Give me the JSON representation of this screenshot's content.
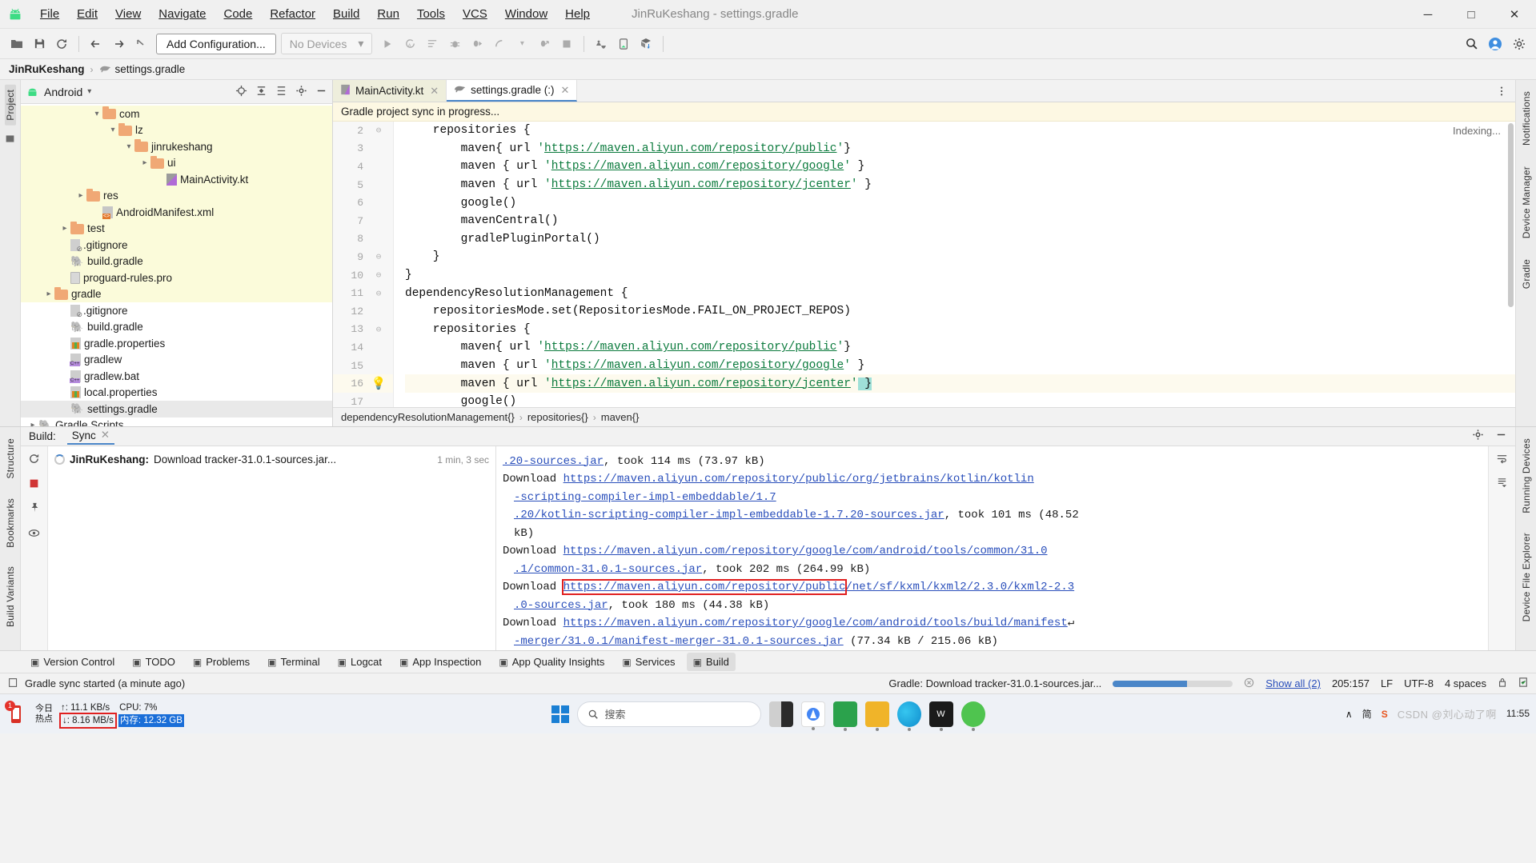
{
  "titlebar": {
    "logo_icon": "android-logo-icon",
    "menus": [
      "File",
      "Edit",
      "View",
      "Navigate",
      "Code",
      "Refactor",
      "Build",
      "Run",
      "Tools",
      "VCS",
      "Window",
      "Help"
    ],
    "window_title": "JinRuKeshang - settings.gradle",
    "minimize": "─",
    "maximize": "□",
    "close": "✕"
  },
  "toolbar": {
    "open_icon": "open-folder-icon",
    "save_icon": "save-icon",
    "sync_icon": "sync-project-icon",
    "back_icon": "back-arrow-icon",
    "forward_icon": "forward-arrow-icon",
    "up_icon": "up-arrow-icon",
    "add_configuration": "Add Configuration...",
    "device_selector": "No Devices",
    "device_caret": "▾",
    "run_icon": "run-icon",
    "apply_changes_icon": "apply-changes-icon",
    "run_with_coverage_icon": "run-coverage-icon",
    "debug_icon": "debug-icon",
    "attach_debugger_icon": "attach-debugger-icon",
    "profile_icon": "profile-icon",
    "profile_caret": "▾",
    "stop_icon": "stop-icon",
    "avd_manager_icon": "avd-manager-icon",
    "device_manager_icon": "device-manager-icon",
    "sdk_manager_icon": "sdk-manager-icon",
    "search_icon": "search-everywhere-icon",
    "account_icon": "account-icon",
    "settings_icon": "settings-gear-icon"
  },
  "navbar": {
    "project_name": "JinRuKeshang",
    "separator": "›",
    "file_name": "settings.gradle",
    "file_icon": "gradle-elephant-icon"
  },
  "left_strip": {
    "project_label": "Project",
    "commit_icon": "commit-icon",
    "structure_label": "Structure",
    "bookmarks_label": "Bookmarks",
    "build_variants_label": "Build Variants"
  },
  "right_strip": {
    "notifications_label": "Notifications",
    "device_manager_label": "Device Manager",
    "gradle_label": "Gradle",
    "running_devices_label": "Running Devices",
    "device_file_explorer_label": "Device File Explorer"
  },
  "project_panel": {
    "title": "Android",
    "dropdown_caret": "▾",
    "locate_icon": "locate-file-icon",
    "expand_icon": "expand-all-icon",
    "collapse_icon": "collapse-all-icon",
    "settings_icon": "panel-settings-icon",
    "hide_icon": "hide-panel-icon",
    "tree": [
      {
        "label": "com",
        "indent": 4,
        "arrow": "open",
        "icon": "folder",
        "hl": true
      },
      {
        "label": "lz",
        "indent": 5,
        "arrow": "open",
        "icon": "folder",
        "hl": true
      },
      {
        "label": "jinrukeshang",
        "indent": 6,
        "arrow": "open",
        "icon": "folder",
        "hl": true
      },
      {
        "label": "ui",
        "indent": 7,
        "arrow": "closed",
        "icon": "folder",
        "hl": true
      },
      {
        "label": "MainActivity.kt",
        "indent": 8,
        "arrow": "none",
        "icon": "kt",
        "hl": true
      },
      {
        "label": "res",
        "indent": 3,
        "arrow": "closed",
        "icon": "folder",
        "hl": true
      },
      {
        "label": "AndroidManifest.xml",
        "indent": 4,
        "arrow": "none",
        "icon": "xml",
        "hl": true
      },
      {
        "label": "test",
        "indent": 2,
        "arrow": "closed",
        "icon": "folder",
        "hl": true
      },
      {
        "label": ".gitignore",
        "indent": 2,
        "arrow": "none",
        "icon": "gitignore",
        "hl": true
      },
      {
        "label": "build.gradle",
        "indent": 2,
        "arrow": "none",
        "icon": "gradle",
        "hl": true
      },
      {
        "label": "proguard-rules.pro",
        "indent": 2,
        "arrow": "none",
        "icon": "file",
        "hl": true
      },
      {
        "label": "gradle",
        "indent": 1,
        "arrow": "closed",
        "icon": "folder",
        "hl": true
      },
      {
        "label": ".gitignore",
        "indent": 2,
        "arrow": "none",
        "icon": "gitignore",
        "hl": false
      },
      {
        "label": "build.gradle",
        "indent": 2,
        "arrow": "none",
        "icon": "gradle",
        "hl": false
      },
      {
        "label": "gradle.properties",
        "indent": 2,
        "arrow": "none",
        "icon": "props",
        "hl": false
      },
      {
        "label": "gradlew",
        "indent": 2,
        "arrow": "none",
        "icon": "bat",
        "hl": false
      },
      {
        "label": "gradlew.bat",
        "indent": 2,
        "arrow": "none",
        "icon": "bat",
        "hl": false
      },
      {
        "label": "local.properties",
        "indent": 2,
        "arrow": "none",
        "icon": "props",
        "hl": false
      },
      {
        "label": "settings.gradle",
        "indent": 2,
        "arrow": "none",
        "icon": "gradle",
        "hl": false,
        "selected": true
      },
      {
        "label": "Gradle Scripts",
        "indent": 0,
        "arrow": "closed",
        "icon": "gradle",
        "hl": false
      }
    ]
  },
  "editor": {
    "tabs": [
      {
        "label": "MainActivity.kt",
        "icon": "kotlin-file-icon",
        "close": "✕",
        "active": false
      },
      {
        "label": "settings.gradle (:)",
        "icon": "gradle-elephant-icon",
        "close": "✕",
        "active": true
      }
    ],
    "more_icon": "more-options-icon",
    "sync_banner": "Gradle project sync in progress...",
    "indexing_label": "Indexing...",
    "lines": [
      {
        "num": "2",
        "fold": "⊖",
        "text": "    repositories {"
      },
      {
        "num": "3",
        "fold": "",
        "text": "        maven{ url 'https://maven.aliyun.com/repository/public'}"
      },
      {
        "num": "4",
        "fold": "",
        "text": "        maven { url 'https://maven.aliyun.com/repository/google' }"
      },
      {
        "num": "5",
        "fold": "",
        "text": "        maven { url 'https://maven.aliyun.com/repository/jcenter' }"
      },
      {
        "num": "6",
        "fold": "",
        "text": "        google()"
      },
      {
        "num": "7",
        "fold": "",
        "text": "        mavenCentral()"
      },
      {
        "num": "8",
        "fold": "",
        "text": "        gradlePluginPortal()"
      },
      {
        "num": "9",
        "fold": "⊖",
        "text": "    }"
      },
      {
        "num": "10",
        "fold": "⊖",
        "text": "}"
      },
      {
        "num": "11",
        "fold": "⊖",
        "text": "dependencyResolutionManagement {"
      },
      {
        "num": "12",
        "fold": "",
        "text": "    repositoriesMode.set(RepositoriesMode.FAIL_ON_PROJECT_REPOS)"
      },
      {
        "num": "13",
        "fold": "⊖",
        "text": "    repositories {"
      },
      {
        "num": "14",
        "fold": "",
        "text": "        maven{ url 'https://maven.aliyun.com/repository/public'}"
      },
      {
        "num": "15",
        "fold": "",
        "text": "        maven { url 'https://maven.aliyun.com/repository/google' }"
      },
      {
        "num": "16",
        "fold": "",
        "text": "        maven { url 'https://maven.aliyun.com/repository/jcenter' }",
        "bulb": true,
        "highlight": true
      },
      {
        "num": "17",
        "fold": "",
        "text": "        google()"
      }
    ],
    "breadcrumbs": [
      "dependencyResolutionManagement{}",
      "repositories{}",
      "maven{}"
    ],
    "breadcrumb_sep": "›"
  },
  "build_panel": {
    "label": "Build:",
    "tab": "Sync",
    "tab_close": "✕",
    "settings_icon": "build-settings-icon",
    "hide_icon": "hide-build-icon",
    "restart_icon": "restart-icon",
    "stop_icon": "stop-square-icon",
    "pin_icon": "pin-icon",
    "eye_icon": "toggle-visibility-icon",
    "task_name": "JinRuKeshang:",
    "task_detail": "Download tracker-31.0.1-sources.jar...",
    "task_time": "1 min, 3 sec",
    "wrap_icon": "soft-wrap-icon",
    "scroll_end_icon": "scroll-to-end-icon",
    "log": [
      {
        "parts": [
          {
            "t": "link",
            "v": ".20-sources.jar"
          },
          {
            "t": "txt",
            "v": ", took 114 ms (73.97 kB)"
          }
        ]
      },
      {
        "parts": [
          {
            "t": "txt",
            "v": "Download "
          },
          {
            "t": "link",
            "v": "https://maven.aliyun.com/repository/public/org/jetbrains/kotlin/kotlin"
          }
        ]
      },
      {
        "parts": [
          {
            "t": "link",
            "v": "-scripting-compiler-impl-embeddable/1.7"
          }
        ],
        "indent": 1
      },
      {
        "parts": [
          {
            "t": "link",
            "v": ".20/kotlin-scripting-compiler-impl-embeddable-1.7.20-sources.jar"
          },
          {
            "t": "txt",
            "v": ", took 101 ms (48.52"
          }
        ],
        "indent": 1
      },
      {
        "parts": [
          {
            "t": "txt",
            "v": "kB)"
          }
        ],
        "indent": 1
      },
      {
        "parts": [
          {
            "t": "txt",
            "v": "Download "
          },
          {
            "t": "link",
            "v": "https://maven.aliyun.com/repository/google/com/android/tools/common/31.0"
          }
        ]
      },
      {
        "parts": [
          {
            "t": "link",
            "v": ".1/common-31.0.1-sources.jar"
          },
          {
            "t": "txt",
            "v": ", took 202 ms (264.99 kB)"
          }
        ],
        "indent": 1
      },
      {
        "parts": [
          {
            "t": "txt",
            "v": "Download "
          },
          {
            "t": "link",
            "v": "https://maven.aliyun.com/repository/public",
            "box": true
          },
          {
            "t": "link",
            "v": "/net/sf/kxml/kxml2/2.3.0/kxml2-2.3"
          }
        ]
      },
      {
        "parts": [
          {
            "t": "link",
            "v": ".0-sources.jar"
          },
          {
            "t": "txt",
            "v": ", took 180 ms (44.38 kB)"
          }
        ],
        "indent": 1
      },
      {
        "parts": [
          {
            "t": "txt",
            "v": "Download "
          },
          {
            "t": "link",
            "v": "https://maven.aliyun.com/repository/google/com/android/tools/build/manifest"
          },
          {
            "t": "txt",
            "v": "↵"
          }
        ]
      },
      {
        "parts": [
          {
            "t": "link",
            "v": "-merger/31.0.1/manifest-merger-31.0.1-sources.jar"
          },
          {
            "t": "txt",
            "v": " (77.34 kB / 215.06 kB)"
          }
        ],
        "indent": 1
      }
    ]
  },
  "tool_tabs": [
    {
      "label": "Version Control",
      "icon": "branch-icon",
      "active": false
    },
    {
      "label": "TODO",
      "icon": "todo-icon",
      "active": false
    },
    {
      "label": "Problems",
      "icon": "problems-icon",
      "active": false
    },
    {
      "label": "Terminal",
      "icon": "terminal-icon",
      "active": false
    },
    {
      "label": "Logcat",
      "icon": "logcat-icon",
      "active": false
    },
    {
      "label": "App Inspection",
      "icon": "app-inspection-icon",
      "active": false
    },
    {
      "label": "App Quality Insights",
      "icon": "app-quality-icon",
      "active": false
    },
    {
      "label": "Services",
      "icon": "services-icon",
      "active": false
    },
    {
      "label": "Build",
      "icon": "build-hammer-icon",
      "active": true
    }
  ],
  "statusbar": {
    "left_icon": "editor-status-icon",
    "message": "Gradle sync started (a minute ago)",
    "gradle_task": "Gradle: Download tracker-31.0.1-sources.jar...",
    "progress_percent": 62,
    "cancel_icon": "cancel-progress-icon",
    "show_all": "Show all (2)",
    "caret_position": "205:157",
    "line_separator": "LF",
    "encoding": "UTF-8",
    "indent": "4 spaces",
    "lock_icon": "read-only-lock-icon",
    "inspection_icon": "inspection-status-icon"
  },
  "taskbar": {
    "hotspot_badge": "1",
    "hotspot_line1": "今日",
    "hotspot_line2": "热点",
    "net_up": "↑: 11.1 KB/s",
    "net_down": "↓: 8.16 MB/s",
    "cpu": "CPU: 7%",
    "memory": "内存: 12.32 GB",
    "search_placeholder": "搜索",
    "search_icon": "search-icon",
    "windows_icon": "windows-start-icon",
    "apps": [
      {
        "name": "task-view-icon",
        "color": "#2b2b2b"
      },
      {
        "name": "android-studio-icon",
        "color": "#4285f4"
      },
      {
        "name": "huawei-icon",
        "color": "#2ba24c"
      },
      {
        "name": "file-explorer-icon",
        "color": "#f0b429"
      },
      {
        "name": "edge-icon",
        "color": "#0f8ccd"
      },
      {
        "name": "wps-icon",
        "color": "#1a1a1a"
      },
      {
        "name": "wechat-icon",
        "color": "#4fc44f"
      }
    ],
    "tray_caret": "∧",
    "ime_label": "简",
    "sogou_label": "S",
    "clock_time": "11:55",
    "watermark": "CSDN @刘心动了啊"
  }
}
